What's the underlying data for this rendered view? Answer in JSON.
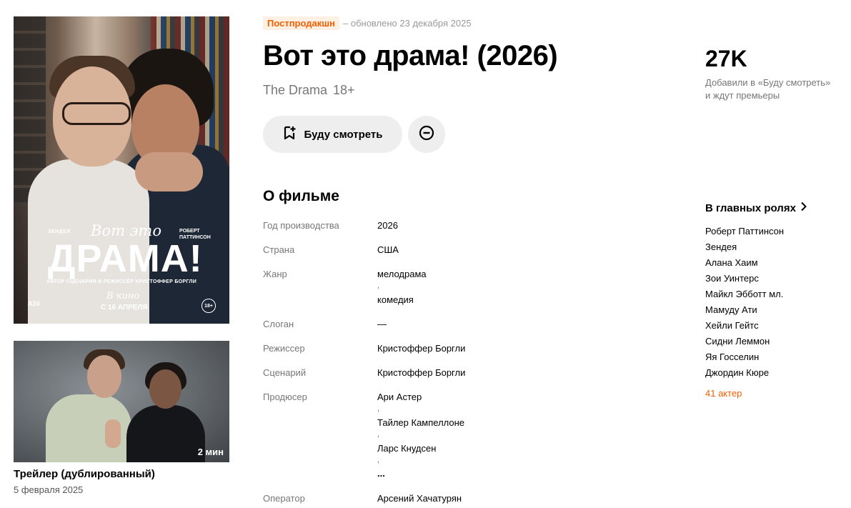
{
  "status": {
    "badge": "Постпродакшн",
    "updated": "– обновлено 23 декабря 2025"
  },
  "film": {
    "title": "Вот это драма! (2026)",
    "original_title": "The Drama",
    "age": "18+"
  },
  "actions": {
    "watch_label": "Буду смотреть"
  },
  "poster": {
    "zendaya": "ЗЕНДЕЯ",
    "pattinson_1": "РОБЕРТ",
    "pattinson_2": "ПАТТИНСОН",
    "vot_eto": "Вот это",
    "drama": "ДРАМА!",
    "credit": "АВТОР СЦЕНАРИЯ И РЕЖИССЁР КРИСТОФФЕР БОРГЛИ",
    "v_kino": "В кино",
    "date": "С 16 АПРЕЛЯ",
    "studio": "A24",
    "age": "18+"
  },
  "trailer": {
    "duration": "2 мин",
    "title": "Трейлер (дублированный)",
    "date": "5 февраля 2025"
  },
  "about": {
    "title": "О фильме",
    "rows": [
      {
        "label": "Год производства",
        "values": [
          "2026"
        ]
      },
      {
        "label": "Страна",
        "values": [
          "США"
        ]
      },
      {
        "label": "Жанр",
        "values": [
          "мелодрама",
          "комедия"
        ]
      },
      {
        "label": "Слоган",
        "values": [
          "—"
        ]
      },
      {
        "label": "Режиссер",
        "values": [
          "Кристоффер Боргли"
        ]
      },
      {
        "label": "Сценарий",
        "values": [
          "Кристоффер Боргли"
        ]
      },
      {
        "label": "Продюсер",
        "values": [
          "Ари Астер",
          "Тайлер Кампеллоне",
          "Ларс Кнудсен",
          "..."
        ]
      },
      {
        "label": "Оператор",
        "values": [
          "Арсений Хачатурян"
        ]
      }
    ]
  },
  "stats": {
    "count": "27K",
    "desc_1": "Добавили в «Буду смотреть»",
    "desc_2": "и ждут премьеры"
  },
  "cast": {
    "title": "В главных ролях",
    "items": [
      "Роберт Паттинсон",
      "Зендея",
      "Алана Хаим",
      "Зои Уинтерс",
      "Майкл Эбботт мл.",
      "Мамуду Ати",
      "Хейли Гейтс",
      "Сидни Леммон",
      "Яя Госселин",
      "Джордин Кюре"
    ],
    "more": "41 актер"
  },
  "icons": {
    "watch": "bookmark-plus-icon",
    "not_interested": "minus-circle-icon",
    "cast_more": "chevron-right-icon"
  },
  "colors": {
    "accent": "#f25f00",
    "badge_bg": "#fff0e4",
    "button_bg": "#eeeeee"
  }
}
